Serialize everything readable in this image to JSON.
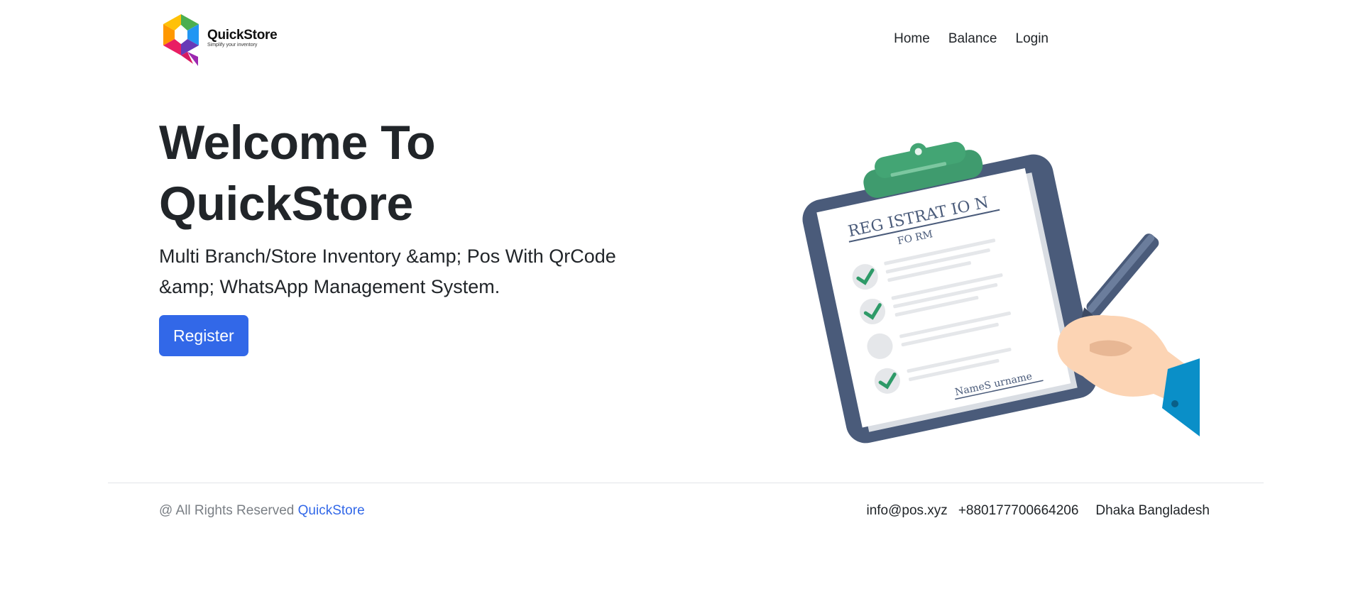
{
  "brand": {
    "name": "QuickStore",
    "tagline": "Simplify your inventory"
  },
  "nav": {
    "items": [
      "Home",
      "Balance",
      "Login"
    ]
  },
  "hero": {
    "title_line1": "Welcome To",
    "title_line2": "QuickStore",
    "subtitle_line1": "Multi Branch/Store Inventory &amp; Pos With QrCode",
    "subtitle_line2": "&amp; WhatsApp Management System.",
    "register_label": "Register"
  },
  "illustration": {
    "form_title": "REG ISTRAT IO N",
    "form_subtitle": "FO RM",
    "signature": "NameS urname"
  },
  "footer": {
    "copyright_prefix": "@ All Rights Reserved",
    "copyright_link": "QuickStore",
    "email": "info@pos.xyz",
    "phone": "+880177700664206",
    "location": "Dhaka Bangladesh"
  },
  "colors": {
    "accent": "#3268e8",
    "text": "#212529",
    "muted": "#7a7f85"
  }
}
